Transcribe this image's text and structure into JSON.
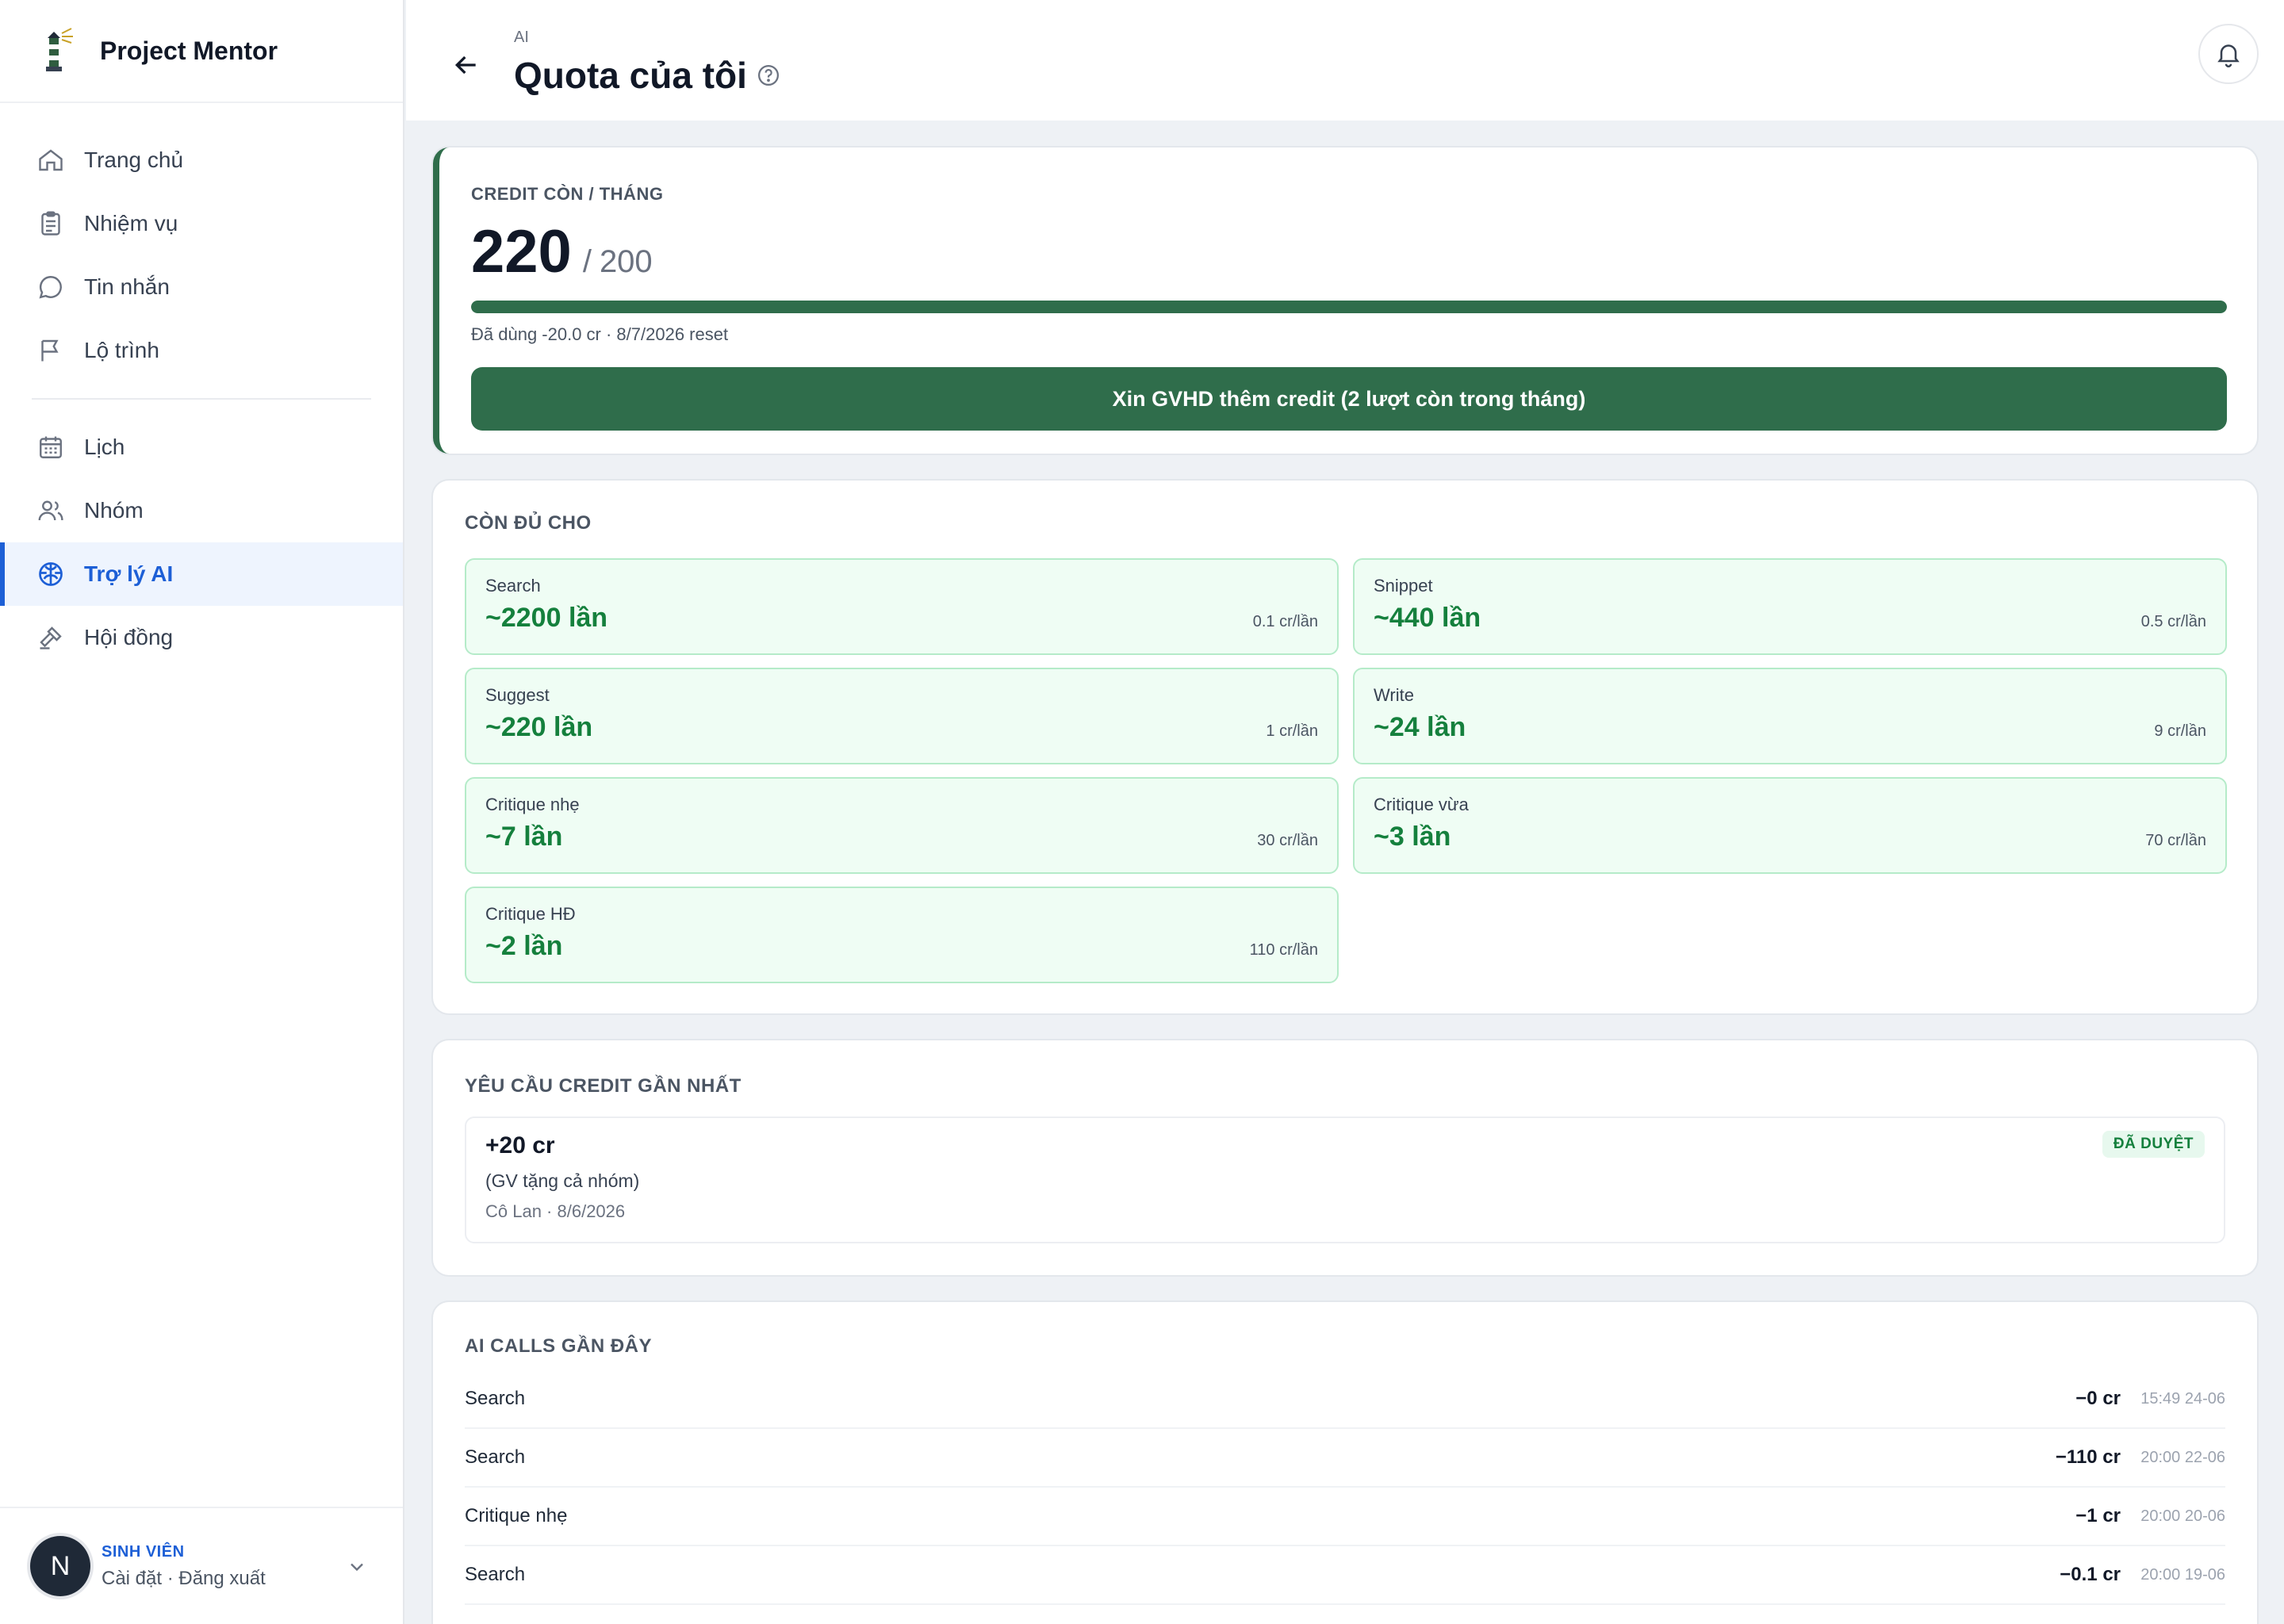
{
  "brand": {
    "name": "Project Mentor"
  },
  "sidebar": {
    "items": [
      {
        "label": "Trang chủ",
        "icon": "home-icon"
      },
      {
        "label": "Nhiệm vụ",
        "icon": "clipboard-icon"
      },
      {
        "label": "Tin nhắn",
        "icon": "chat-icon"
      },
      {
        "label": "Lộ trình",
        "icon": "flag-icon"
      },
      {
        "label": "Lịch",
        "icon": "calendar-icon"
      },
      {
        "label": "Nhóm",
        "icon": "users-icon"
      },
      {
        "label": "Trợ lý AI",
        "icon": "brain-icon",
        "active": true
      },
      {
        "label": "Hội đồng",
        "icon": "gavel-icon"
      }
    ]
  },
  "user": {
    "avatar": "N",
    "role": "SINH VIÊN",
    "links": "Cài đặt · Đăng xuất"
  },
  "header": {
    "crumb": "AI",
    "title": "Quota của tôi"
  },
  "credit": {
    "label": "CREDIT CÒN / THÁNG",
    "remaining": "220",
    "separator": "/",
    "total": "200",
    "progress_percent": 100,
    "note": "Đã dùng -20.0 cr · 8/7/2026 reset",
    "button": "Xin GVHD thêm credit (2 lượt còn trong tháng)"
  },
  "enough": {
    "title": "CÒN ĐỦ CHO",
    "tiles": [
      {
        "name": "Search",
        "count": "~2200 lần",
        "cost": "0.1 cr/lần"
      },
      {
        "name": "Snippet",
        "count": "~440 lần",
        "cost": "0.5 cr/lần"
      },
      {
        "name": "Suggest",
        "count": "~220 lần",
        "cost": "1 cr/lần"
      },
      {
        "name": "Write",
        "count": "~24 lần",
        "cost": "9 cr/lần"
      },
      {
        "name": "Critique nhẹ",
        "count": "~7 lần",
        "cost": "30 cr/lần"
      },
      {
        "name": "Critique vừa",
        "count": "~3 lần",
        "cost": "70 cr/lần"
      },
      {
        "name": "Critique HĐ",
        "count": "~2 lần",
        "cost": "110 cr/lần"
      }
    ]
  },
  "requests": {
    "title": "YÊU CẦU CREDIT GẦN NHẤT",
    "items": [
      {
        "amount": "+20 cr",
        "reason": "(GV tặng cả nhóm)",
        "meta": "Cô Lan · 8/6/2026",
        "status": "ĐÃ DUYỆT"
      }
    ]
  },
  "calls": {
    "title": "AI CALLS GẦN ĐÂY",
    "rows": [
      {
        "name": "Search",
        "cost": "−0 cr",
        "time": "15:49 24-06"
      },
      {
        "name": "Search",
        "cost": "−110 cr",
        "time": "20:00 22-06"
      },
      {
        "name": "Critique nhẹ",
        "cost": "−1 cr",
        "time": "20:00 20-06"
      },
      {
        "name": "Search",
        "cost": "−0.1 cr",
        "time": "20:00 19-06"
      }
    ]
  }
}
